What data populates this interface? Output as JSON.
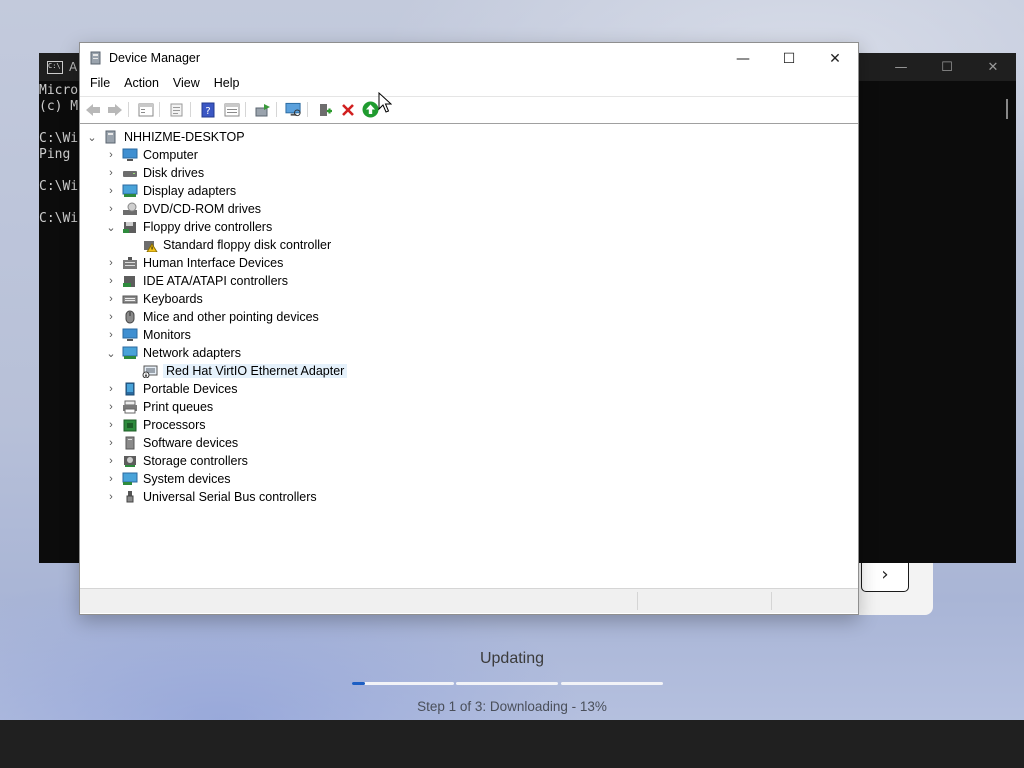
{
  "console": {
    "title": "A",
    "text": "Micro\n(c) M\n\nC:\\Wi\nPing \n\nC:\\Wi\n\nC:\\Wi",
    "ctrl_min": "—",
    "ctrl_max": "☐",
    "ctrl_close": "✕"
  },
  "window": {
    "title": "Device Manager",
    "ctrl_min": "—",
    "ctrl_max": "☐",
    "ctrl_close": "✕"
  },
  "menu": [
    "File",
    "Action",
    "View",
    "Help"
  ],
  "toolbar": {
    "icons": [
      "back-icon",
      "forward-icon",
      "show-hide-tree-icon",
      "properties-icon",
      "help-icon",
      "resources-icon",
      "update-driver-icon",
      "scan-hardware-icon",
      "add-legacy-icon",
      "uninstall-icon",
      "enable-device-icon"
    ]
  },
  "tree": {
    "root": "NHHIZME-DESKTOP",
    "items": [
      {
        "label": "Computer",
        "icon": "computer-icon",
        "expanded": false
      },
      {
        "label": "Disk drives",
        "icon": "disk-drive-icon",
        "expanded": false
      },
      {
        "label": "Display adapters",
        "icon": "display-adapter-icon",
        "expanded": false
      },
      {
        "label": "DVD/CD-ROM drives",
        "icon": "dvd-drive-icon",
        "expanded": false
      },
      {
        "label": "Floppy drive controllers",
        "icon": "floppy-controller-icon",
        "expanded": true
      },
      {
        "label": "Standard floppy disk controller",
        "icon": "warning-device-icon",
        "child": true
      },
      {
        "label": "Human Interface Devices",
        "icon": "hid-icon",
        "expanded": false
      },
      {
        "label": "IDE ATA/ATAPI controllers",
        "icon": "ide-controller-icon",
        "expanded": false
      },
      {
        "label": "Keyboards",
        "icon": "keyboard-icon",
        "expanded": false
      },
      {
        "label": "Mice and other pointing devices",
        "icon": "mouse-icon",
        "expanded": false
      },
      {
        "label": "Monitors",
        "icon": "monitor-icon",
        "expanded": false
      },
      {
        "label": "Network adapters",
        "icon": "network-adapter-icon",
        "expanded": true
      },
      {
        "label": "Red Hat VirtIO Ethernet Adapter",
        "icon": "ethernet-adapter-icon",
        "child": true,
        "selected": true
      },
      {
        "label": "Portable Devices",
        "icon": "portable-device-icon",
        "expanded": false
      },
      {
        "label": "Print queues",
        "icon": "printer-icon",
        "expanded": false
      },
      {
        "label": "Processors",
        "icon": "processor-icon",
        "expanded": false
      },
      {
        "label": "Software devices",
        "icon": "software-device-icon",
        "expanded": false
      },
      {
        "label": "Storage controllers",
        "icon": "storage-controller-icon",
        "expanded": false
      },
      {
        "label": "System devices",
        "icon": "system-device-icon",
        "expanded": false
      },
      {
        "label": "Universal Serial Bus controllers",
        "icon": "usb-icon",
        "expanded": false
      }
    ]
  },
  "setup": {
    "next_glyph": "›",
    "status_title": "Updating",
    "step_text": "Step 1 of 3: Downloading - 13%",
    "progress_percent": 13
  },
  "colors": {
    "accent": "#1d5fc4",
    "selection": "#e5f1fb",
    "console_bg": "#0c0c0c"
  }
}
